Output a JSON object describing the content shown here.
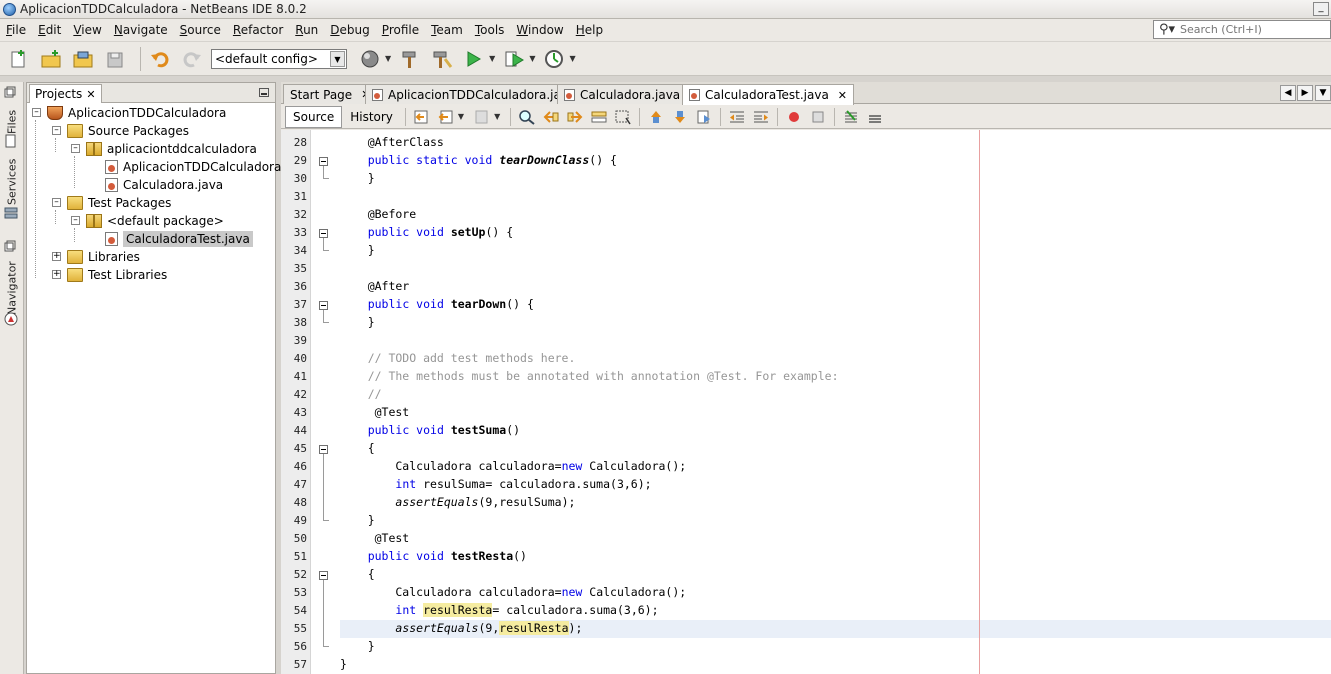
{
  "window": {
    "title": "AplicacionTDDCalculadora - NetBeans IDE 8.0.2"
  },
  "menu": [
    "File",
    "Edit",
    "View",
    "Navigate",
    "Source",
    "Refactor",
    "Run",
    "Debug",
    "Profile",
    "Team",
    "Tools",
    "Window",
    "Help"
  ],
  "search": {
    "placeholder": "Search (Ctrl+I)"
  },
  "toolbar": {
    "config": "<default config>"
  },
  "side_tabs": [
    "Files",
    "Services",
    "Navigator"
  ],
  "projects": {
    "tab_label": "Projects",
    "tree": [
      "AplicacionTDDCalculadora",
      "Source Packages",
      "aplicaciontddcalculadora",
      "AplicacionTDDCalculadora.java",
      "Calculadora.java",
      "Test Packages",
      "<default package>",
      "CalculadoraTest.java",
      "Libraries",
      "Test Libraries"
    ]
  },
  "editor": {
    "tabs": [
      "Start Page",
      "AplicacionTDDCalculadora.java",
      "Calculadora.java",
      "CalculadoraTest.java"
    ],
    "active_tab": "CalculadoraTest.java",
    "source_label": "Source",
    "history_label": "History",
    "line_numbers": [
      "28",
      "29",
      "30",
      "31",
      "32",
      "33",
      "34",
      "35",
      "36",
      "37",
      "38",
      "39",
      "40",
      "41",
      "42",
      "43",
      "44",
      "45",
      "46",
      "47",
      "48",
      "49",
      "50",
      "51",
      "52",
      "53",
      "54",
      "55",
      "56",
      "57"
    ],
    "code": {
      "l28": "    @AfterClass",
      "l29a": "    ",
      "l29kw": "public static void",
      "l29sp": " ",
      "l29m": "tearDownClass",
      "l29b": "() {",
      "l30": "    }",
      "l31": "",
      "l32": "    @Before",
      "l33a": "    ",
      "l33kw": "public void",
      "l33sp": " ",
      "l33m": "setUp",
      "l33b": "() {",
      "l34": "    }",
      "l35": "",
      "l36": "    @After",
      "l37a": "    ",
      "l37kw": "public void",
      "l37sp": " ",
      "l37m": "tearDown",
      "l37b": "() {",
      "l38": "    }",
      "l39": "",
      "l40": "    // TODO add test methods here.",
      "l41": "    // The methods must be annotated with annotation @Test. For example:",
      "l42": "    //",
      "l43": "     @Test",
      "l44a": "    ",
      "l44kw": "public void",
      "l44sp": " ",
      "l44m": "testSuma",
      "l44b": "()",
      "l45": "    {",
      "l46a": "        Calculadora calculadora=",
      "l46kw": "new",
      "l46b": " Calculadora();",
      "l47a": "        ",
      "l47kw": "int",
      "l47b": " resulSuma= calculadora.suma(3,6);",
      "l48a": "        ",
      "l48m": "assertEquals",
      "l48b": "(9,resulSuma);",
      "l49": "    }",
      "l50": "     @Test",
      "l51a": "    ",
      "l51kw": "public void",
      "l51sp": " ",
      "l51m": "testResta",
      "l51b": "()",
      "l52": "    {",
      "l53a": "        Calculadora calculadora=",
      "l53kw": "new",
      "l53b": " Calculadora();",
      "l54a": "        ",
      "l54kw": "int",
      "l54sp": " ",
      "l54h": "resulResta",
      "l54b": "= calculadora.suma(3,6);",
      "l55a": "        ",
      "l55m": "assertEquals",
      "l55b": "(9,",
      "l55h": "resulResta",
      "l55c": ");",
      "l56": "    }",
      "l57": "}"
    }
  }
}
